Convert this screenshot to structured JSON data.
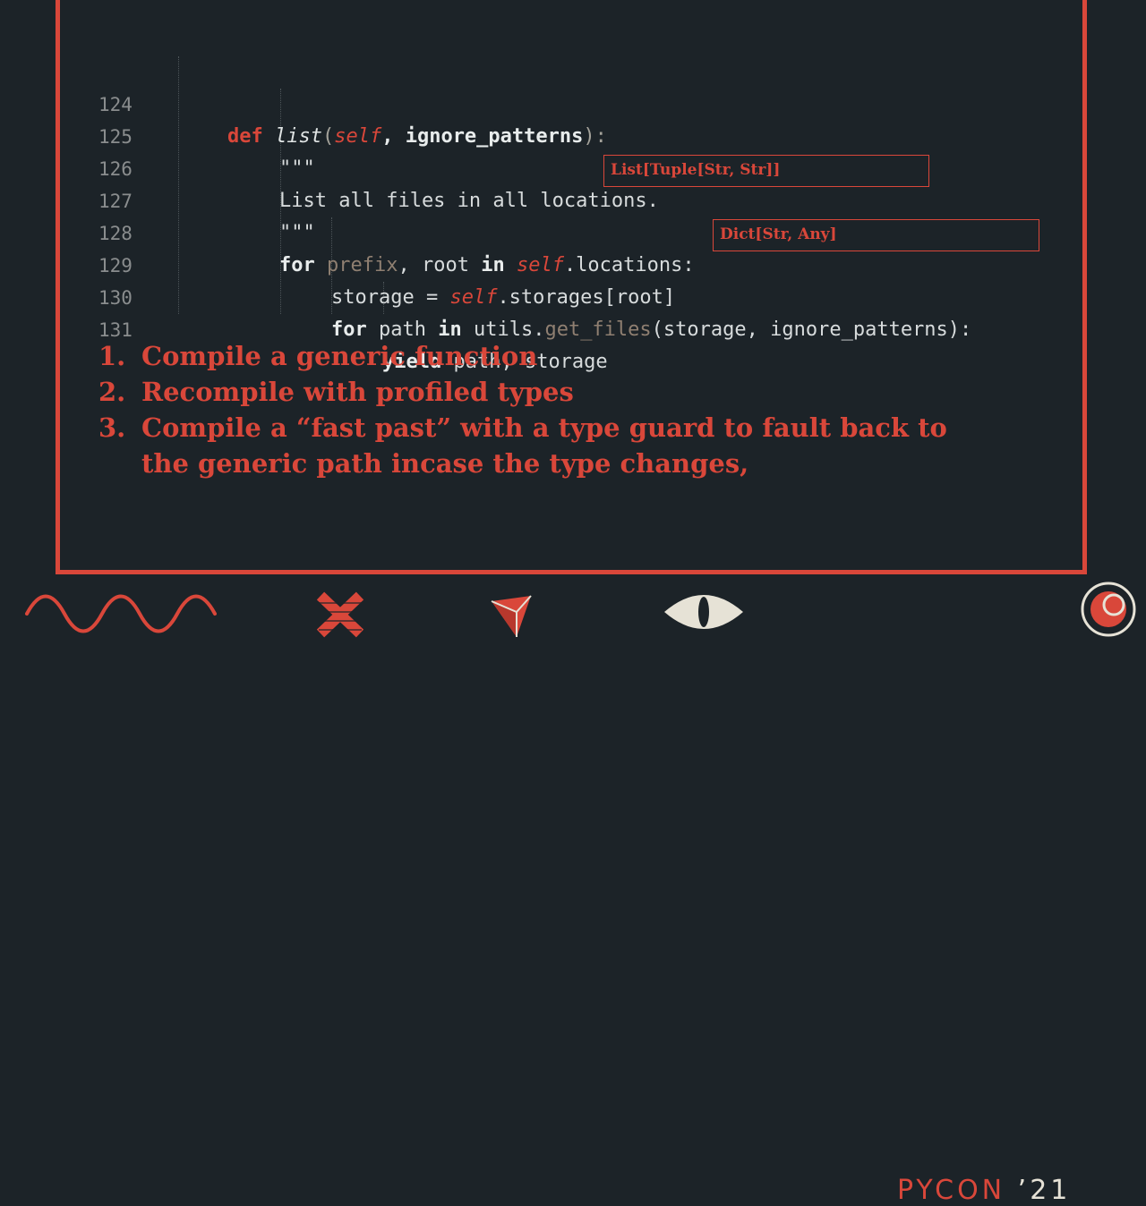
{
  "code": {
    "line_numbers": [
      "124",
      "125",
      "126",
      "127",
      "128",
      "129",
      "130",
      "131"
    ],
    "line124": {
      "kw": "def",
      "name": "list",
      "open": "(",
      "self": "self",
      "rest": ", ignore_patterns",
      "close": "):"
    },
    "line125": "\"\"\"",
    "line126": "List all files in all locations.",
    "line127": "\"\"\"",
    "line128": {
      "for": "for",
      "prefix": "prefix",
      "mid": ", root ",
      "in": "in",
      "self": "self",
      "rest": ".locations:"
    },
    "line129": {
      "pre": "storage = ",
      "self": "self",
      "rest": ".storages[root]"
    },
    "line130": {
      "for": "for",
      "mid": " path ",
      "in": "in",
      "utils": " utils.",
      "call": "get_files",
      "rest": "(storage, ignore_patterns):"
    },
    "line131": {
      "kw": "yield",
      "rest": " path, storage"
    }
  },
  "annotations": {
    "type1": "List[Tuple[Str, Str]]",
    "type2": "Dict[Str, Any]"
  },
  "steps": [
    {
      "num": "1.",
      "text": "Compile a generic function"
    },
    {
      "num": "2.",
      "text": "Recompile with profiled types"
    },
    {
      "num": "3.",
      "text": "Compile a “fast past” with a type guard to fault back to the generic path incase the type changes,"
    }
  ],
  "footer": {
    "brand": "PYCON",
    "year": " ’21"
  },
  "colors": {
    "accent": "#d9473a",
    "background": "#1c2328",
    "cream": "#e6e2d6"
  },
  "icons": [
    "wave-icon",
    "x-cross-icon",
    "paper-plane-icon",
    "eye-icon",
    "target-logo-icon"
  ]
}
